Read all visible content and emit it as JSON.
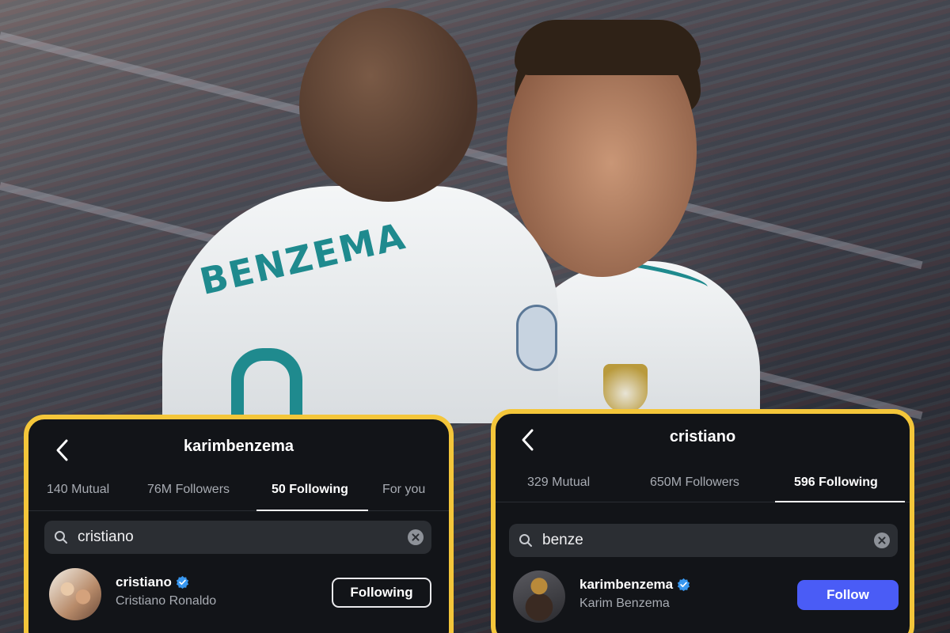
{
  "left_panel": {
    "title": "karimbenzema",
    "tabs": [
      {
        "label": "140 Mutual"
      },
      {
        "label": "76M Followers"
      },
      {
        "label": "50 Following",
        "active": true
      },
      {
        "label": "For you"
      }
    ],
    "search": {
      "value": "cristiano"
    },
    "result": {
      "username": "cristiano",
      "full_name": "Cristiano Ronaldo",
      "verified": true,
      "button_label": "Following"
    }
  },
  "right_panel": {
    "title": "cristiano",
    "tabs": [
      {
        "label": "329 Mutual"
      },
      {
        "label": "650M Followers"
      },
      {
        "label": "596 Following",
        "active": true
      }
    ],
    "search": {
      "value": "benze"
    },
    "result": {
      "username": "karimbenzema",
      "full_name": "Karim Benzema",
      "verified": true,
      "button_label": "Follow"
    }
  },
  "background": {
    "jersey_name": "BENZEMA"
  },
  "colors": {
    "panel_border": "#f4c63a",
    "panel_bg": "#121418",
    "follow_button": "#4a5cf6",
    "verified_badge": "#3897f0",
    "jersey_teal": "#1f8a8e"
  },
  "icons": [
    "chevron-left-icon",
    "search-icon",
    "clear-icon",
    "verified-badge-icon"
  ]
}
